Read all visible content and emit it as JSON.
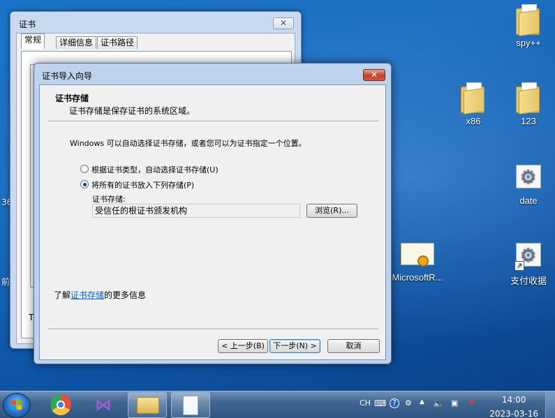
{
  "desktop": {
    "icons": [
      {
        "label": "spy++"
      },
      {
        "label": "x86"
      },
      {
        "label": "123"
      },
      {
        "label": "date"
      },
      {
        "label": "MicrosoftR..."
      },
      {
        "label": "支付收据"
      }
    ],
    "edge_fragments": [
      "36",
      "前"
    ]
  },
  "cert_window": {
    "title": "证书",
    "close_glyph": "✕",
    "tabs": [
      "常规",
      "详细信息",
      "证书路径"
    ],
    "fragment": "T"
  },
  "wizard": {
    "title": "证书导入向导",
    "close_glyph": "✕",
    "header_title": "证书存储",
    "header_subtitle": "证书存储是保存证书的系统区域。",
    "description": "Windows 可以自动选择证书存储，或者您可以为证书指定一个位置。",
    "radio_auto": "根据证书类型，自动选择证书存储(U)",
    "radio_manual": "将所有的证书放入下列存储(P)",
    "selected": "manual",
    "store_label": "证书存储:",
    "store_value": "受信任的根证书颁发机构",
    "browse_button": "浏览(R)...",
    "learn_prefix": "了解",
    "learn_link": "证书存储",
    "learn_suffix": "的更多信息",
    "back_button": "< 上一步(B)",
    "next_button": "下一步(N) >",
    "cancel_button": "取消"
  },
  "taskbar": {
    "tray_lang": "CH",
    "time": "14:00",
    "date": "2023-03-16"
  }
}
